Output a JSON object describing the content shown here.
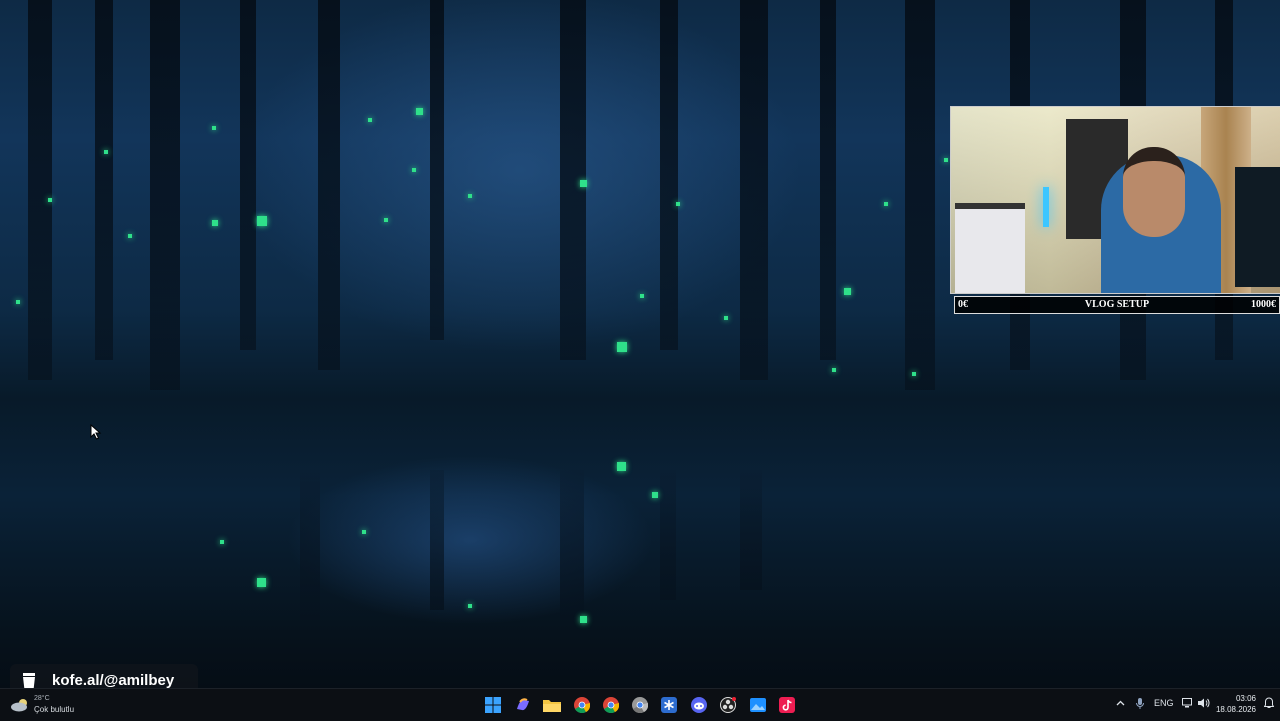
{
  "webcam": {
    "goal_start": "0€",
    "goal_title": "VLOG SETUP",
    "goal_end": "1000€",
    "goal_progress": 0
  },
  "kofe": {
    "text": "kofe.al/@amilbey",
    "icon": "coffee-cup-icon"
  },
  "taskbar": {
    "weather": {
      "temp": "28°C",
      "desc": "Çok bulutlu",
      "icon": "cloud-moon-icon"
    },
    "apps": [
      {
        "name": "start-icon"
      },
      {
        "name": "copilot-icon"
      },
      {
        "name": "file-explorer-icon"
      },
      {
        "name": "chrome-icon"
      },
      {
        "name": "chrome-icon-2"
      },
      {
        "name": "chrome-icon-3"
      },
      {
        "name": "snowflake-app-icon"
      },
      {
        "name": "discord-icon"
      },
      {
        "name": "obs-studio-icon"
      },
      {
        "name": "photos-icon"
      },
      {
        "name": "tiktok-icon"
      }
    ],
    "tray": {
      "chevron_icon": "chevron-up-icon",
      "language": "ENG",
      "time": "03:06",
      "date": "18.08.2026"
    }
  },
  "colors": {
    "firefly": "#2fe08a",
    "taskbar_bg": "#0c0f14",
    "forest_dark": "#07121c"
  }
}
